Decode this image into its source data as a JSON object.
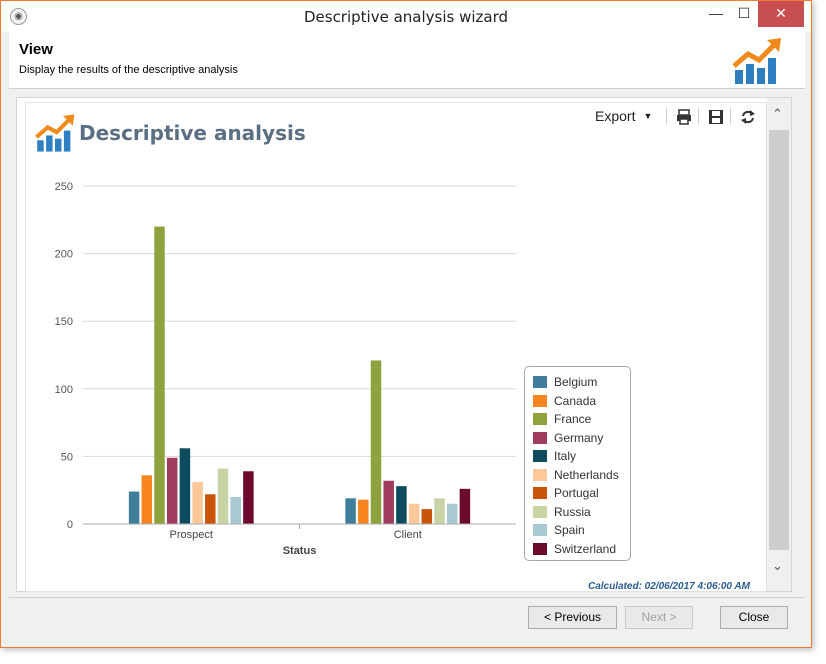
{
  "window": {
    "title": "Descriptive analysis wizard"
  },
  "header": {
    "title": "View",
    "subtitle": "Display the results of the descriptive analysis"
  },
  "report": {
    "title": "Descriptive analysis",
    "export_label": "Export",
    "calculated": "Calculated: 02/06/2017 4:06:00 AM",
    "toolbar_icons": [
      "print-icon",
      "save-icon",
      "refresh-icon"
    ]
  },
  "chart_data": {
    "type": "bar",
    "xlabel": "Status",
    "ylabel": "",
    "ylim": [
      0,
      250
    ],
    "yticks": [
      0,
      50,
      100,
      150,
      200,
      250
    ],
    "grid": true,
    "legend_position": "right",
    "categories": [
      "Prospect",
      "Client"
    ],
    "series": [
      {
        "name": "Belgium",
        "color": "#3f7f9b",
        "values": [
          24,
          19
        ]
      },
      {
        "name": "Canada",
        "color": "#f7841f",
        "values": [
          36,
          18
        ]
      },
      {
        "name": "France",
        "color": "#8ea23d",
        "values": [
          220,
          121
        ]
      },
      {
        "name": "Germany",
        "color": "#a03c5e",
        "values": [
          49,
          32
        ]
      },
      {
        "name": "Italy",
        "color": "#0f4b5e",
        "values": [
          56,
          28
        ]
      },
      {
        "name": "Netherlands",
        "color": "#fcc89a",
        "values": [
          31,
          15
        ]
      },
      {
        "name": "Portugal",
        "color": "#c8540b",
        "values": [
          22,
          11
        ]
      },
      {
        "name": "Russia",
        "color": "#c8d4a6",
        "values": [
          41,
          19
        ]
      },
      {
        "name": "Spain",
        "color": "#a8c8d2",
        "values": [
          20,
          15
        ]
      },
      {
        "name": "Switzerland",
        "color": "#6c0a2e",
        "values": [
          39,
          26
        ]
      }
    ]
  },
  "footer": {
    "previous": "< Previous",
    "next": "Next >",
    "close": "Close"
  }
}
